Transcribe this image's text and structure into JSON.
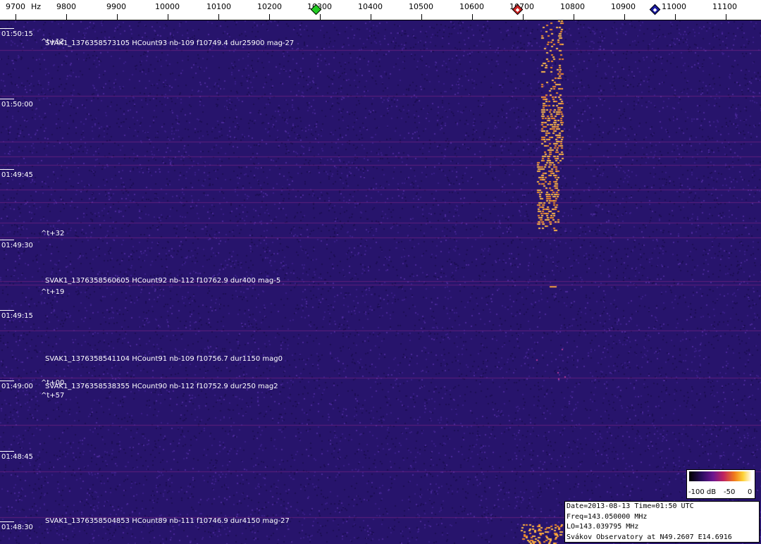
{
  "freq_axis": {
    "unit": "Hz",
    "ticks": [
      "9700",
      "9800",
      "9900",
      "10000",
      "10100",
      "10200",
      "10300",
      "10400",
      "10500",
      "10600",
      "10700",
      "10800",
      "10900",
      "11000",
      "11100"
    ],
    "markers": [
      {
        "name": "green-marker",
        "freq": 10300,
        "color": "#22cc22"
      },
      {
        "name": "red-marker",
        "freq": 10690,
        "color": "#cc2222"
      },
      {
        "name": "blue-marker",
        "freq": 10965,
        "color": "#1a1aa0"
      }
    ]
  },
  "time_axis": {
    "labels": [
      "01:50:15",
      "01:50:00",
      "01:49:45",
      "01:49:30",
      "01:49:15",
      "01:49:00",
      "01:48:45",
      "01:48:30"
    ]
  },
  "events": [
    {
      "text": "SVAK1_1376358573105 HCount93 nb-109 f10749.4  dur25900  mag-27",
      "dt": "^t+12"
    },
    {
      "text": "",
      "dt": "^t+32"
    },
    {
      "text": "SVAK1_1376358560605 HCount92 nb-112 f10762.9  dur400  mag-5",
      "dt": "^t+19"
    },
    {
      "text": "SVAK1_1376358541104 HCount91 nb-109 f10756.7  dur1150  mag0",
      "dt": "^t+00"
    },
    {
      "text": "SVAK1_1376358538355 HCount90 nb-112 f10752.9  dur250  mag2",
      "dt": "^t+57"
    },
    {
      "text": "SVAK1_1376358504853 HCount89 nb-111 f10746.9  dur4150  mag-27",
      "dt": ""
    }
  ],
  "legend": {
    "min_label": "-100 dB",
    "mid_label": "-50",
    "max_label": "0"
  },
  "info": {
    "line1": "Date=2013-08-13 Time=01:50 UTC",
    "line2": "Freq=143.050000 MHz",
    "line3": "LO=143.039795 MHz",
    "line4": "Svákov Observatory at N49.2607 E14.6916"
  },
  "colors": {
    "background": "#27146c",
    "signal": "#fdb84a",
    "line": "#7a2a8a"
  }
}
